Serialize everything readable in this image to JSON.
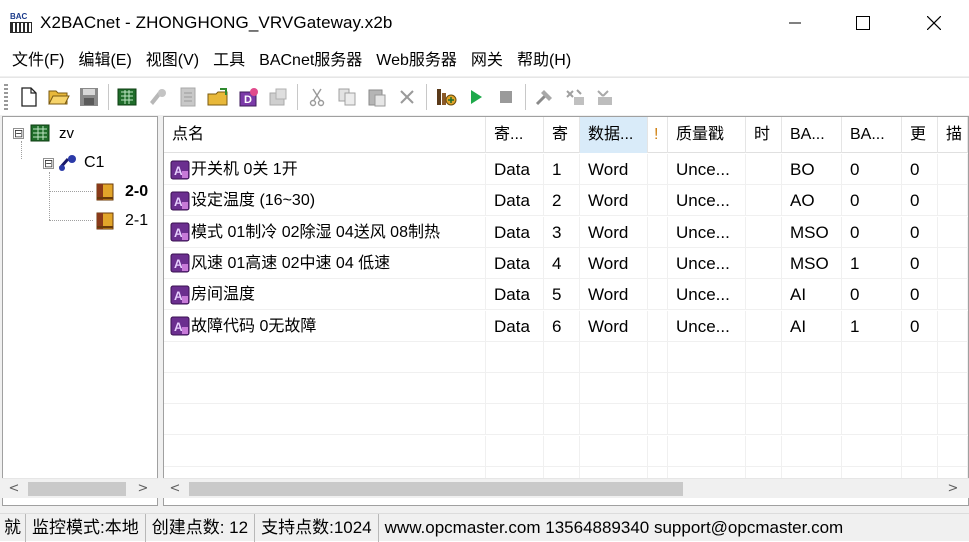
{
  "window": {
    "title": "X2BACnet - ZHONGHONG_VRVGateway.x2b",
    "icon_text": "BAC",
    "controls": [
      "minimize-icon",
      "maximize-icon",
      "close-icon"
    ]
  },
  "menu": [
    "文件(F)",
    "编辑(E)",
    "视图(V)",
    "工具",
    "BACnet服务器",
    "Web服务器",
    "网关",
    "帮助(H)"
  ],
  "toolbar": {
    "buttons": [
      "new-icon",
      "open-icon",
      "save-icon",
      "add-device-icon",
      "add-group-icon",
      "properties-icon",
      "import-icon",
      "add-points-icon",
      "settings-icon",
      "cut-icon",
      "copy-icon",
      "paste-icon",
      "delete-icon",
      "monitor-icon",
      "start-icon",
      "stop-icon",
      "tools-icon",
      "tool2-icon",
      "tool3-icon"
    ]
  },
  "tree": {
    "root": {
      "label": "zv",
      "expander": "⊟"
    },
    "channel": {
      "label": "C1",
      "expander": "⊟"
    },
    "devices": [
      {
        "label": "2-0"
      },
      {
        "label": "2-1"
      }
    ]
  },
  "grid": {
    "columns": [
      "点名",
      "寄...",
      "寄",
      "数据...",
      "!",
      "质量戳",
      "时",
      "BA...",
      "BA...",
      "更",
      "描"
    ],
    "rows": [
      {
        "name": "开关机 0关 1开",
        "reg_type": "Data",
        "reg": "1",
        "data_type": "Word",
        "quality": "Unce...",
        "ba_type": "BO",
        "ba_inst": "0",
        "update": "0"
      },
      {
        "name": "设定温度 (16~30)",
        "reg_type": "Data",
        "reg": "2",
        "data_type": "Word",
        "quality": "Unce...",
        "ba_type": "AO",
        "ba_inst": "0",
        "update": "0"
      },
      {
        "name": "模式 01制冷 02除湿 04送风 08制热",
        "reg_type": "Data",
        "reg": "3",
        "data_type": "Word",
        "quality": "Unce...",
        "ba_type": "MSO",
        "ba_inst": "0",
        "update": "0"
      },
      {
        "name": "风速 01高速 02中速 04 低速",
        "reg_type": "Data",
        "reg": "4",
        "data_type": "Word",
        "quality": "Unce...",
        "ba_type": "MSO",
        "ba_inst": "1",
        "update": "0"
      },
      {
        "name": "房间温度",
        "reg_type": "Data",
        "reg": "5",
        "data_type": "Word",
        "quality": "Unce...",
        "ba_type": "AI",
        "ba_inst": "0",
        "update": "0"
      },
      {
        "name": "故障代码  0无故障",
        "reg_type": "Data",
        "reg": "6",
        "data_type": "Word",
        "quality": "Unce...",
        "ba_type": "AI",
        "ba_inst": "1",
        "update": "0"
      }
    ]
  },
  "scroll": {
    "left_arrow": "<",
    "right_arrow": ">"
  },
  "status": {
    "ready": "就",
    "mode": "监控模式:本地",
    "created": "创建点数:  12",
    "supported": "支持点数:1024",
    "contact": "www.opcmaster.com 13564889340 support@opcmaster.com"
  }
}
